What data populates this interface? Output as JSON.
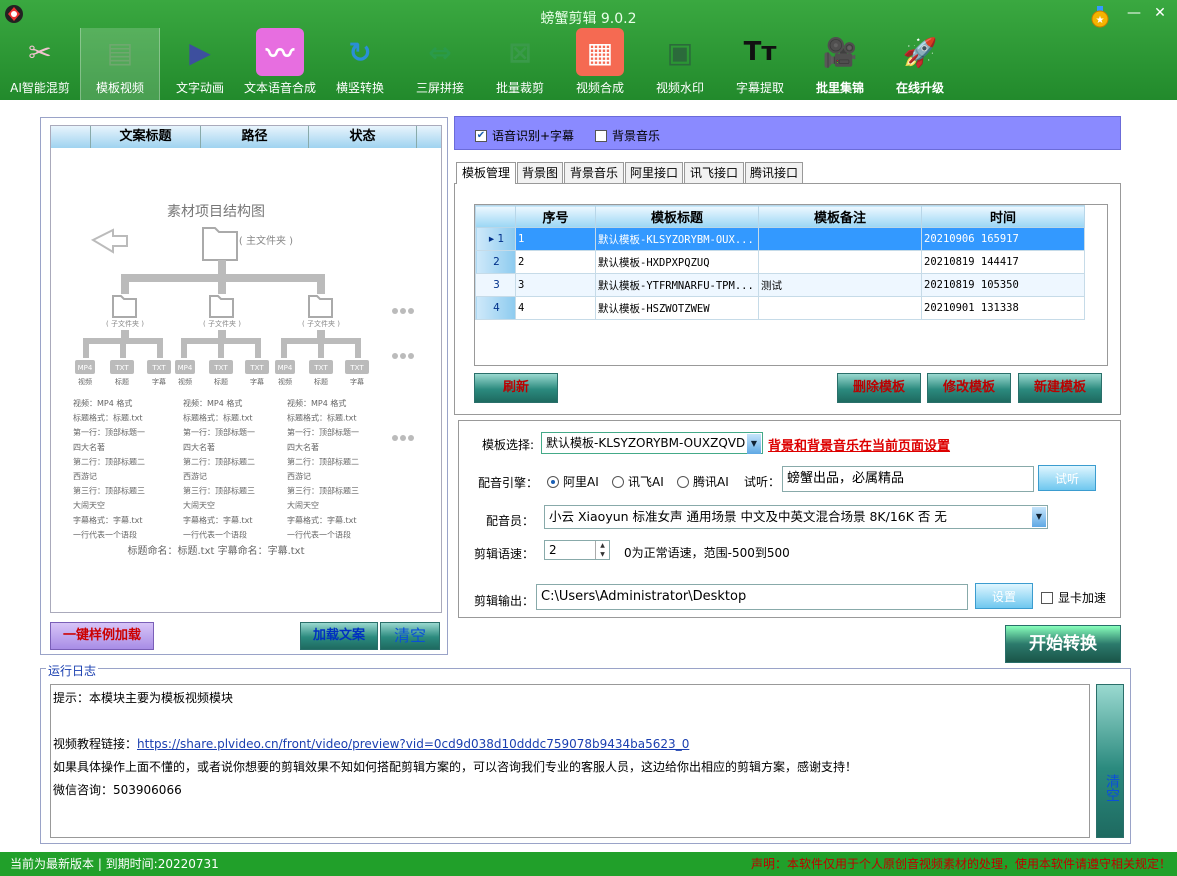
{
  "window": {
    "title": "螃蟹剪辑 9.0.2"
  },
  "toolbar": [
    {
      "label": "AI智能混剪",
      "icon": "ai-mix-icon"
    },
    {
      "label": "模板视频",
      "icon": "template-video-icon"
    },
    {
      "label": "文字动画",
      "icon": "text-animation-icon"
    },
    {
      "label": "文本语音合成",
      "icon": "tts-icon"
    },
    {
      "label": "横竖转换",
      "icon": "rotate-icon"
    },
    {
      "label": "三屏拼接",
      "icon": "three-screen-icon"
    },
    {
      "label": "批量裁剪",
      "icon": "crop-icon"
    },
    {
      "label": "视频合成",
      "icon": "video-merge-icon"
    },
    {
      "label": "视频水印",
      "icon": "watermark-icon"
    },
    {
      "label": "字幕提取",
      "icon": "subtitle-icon"
    },
    {
      "label": "批里集锦",
      "icon": "camera-icon"
    },
    {
      "label": "在线升级",
      "icon": "rocket-icon"
    }
  ],
  "left": {
    "columns": [
      "文案标题",
      "路径",
      "状态"
    ],
    "diagram": {
      "title": "素材项目结构图",
      "main_folder": "( 主文件夹 )",
      "sub_folder": "( 子文件夹 )",
      "file_labels": [
        "视频",
        "标题",
        "字幕"
      ],
      "txt_label": "TXT",
      "mp4_label": "MP4",
      "notes": [
        "视频：MP4 格式",
        "标题格式：标题.txt",
        "第一行：顶部标题一",
        "四大名著",
        "第二行：顶部标题二",
        "西游记",
        "第三行：顶部标题三",
        "大闹天空",
        "字幕格式：字幕.txt",
        "一行代表一个语段"
      ],
      "footer": "标题命名：标题.txt 字幕命名：字幕.txt"
    },
    "btn_sample": "一键样例加载",
    "btn_load": "加载文案",
    "btn_clear": "清空"
  },
  "options": {
    "asr_label": "语音识别+字幕",
    "asr_checked": true,
    "bgm_label": "背景音乐",
    "bgm_checked": false
  },
  "tabs": [
    "模板管理",
    "背景图",
    "背景音乐",
    "阿里接口",
    "讯飞接口",
    "腾讯接口"
  ],
  "template_table": {
    "columns": [
      "序号",
      "模板标题",
      "模板备注",
      "时间"
    ],
    "rows": [
      {
        "idx": "1",
        "no": "1",
        "title": "默认模板-KLSYZORYBM-OUX...",
        "note": "",
        "time": "20210906 165917"
      },
      {
        "idx": "2",
        "no": "2",
        "title": "默认模板-HXDPXPQZUQ",
        "note": "",
        "time": "20210819 144417"
      },
      {
        "idx": "3",
        "no": "3",
        "title": "默认模板-YTFRMNARFU-TPM...",
        "note": "测试",
        "time": "20210819 105350"
      },
      {
        "idx": "4",
        "no": "4",
        "title": "默认模板-HSZWOTZWEW",
        "note": "",
        "time": "20210901 131338"
      }
    ],
    "selected_row": 0
  },
  "table_buttons": {
    "refresh": "刷新",
    "delete": "删除模板",
    "modify": "修改模板",
    "new": "新建模板"
  },
  "settings": {
    "template_label": "模板选择:",
    "template_value": "默认模板-KLSYZORYBM-OUXZQVD",
    "template_hint": "背景和背景音乐在当前页面设置",
    "engine_label": "配音引擎：",
    "engines": [
      "阿里AI",
      "讯飞AI",
      "腾讯AI"
    ],
    "engine_selected": 0,
    "trial_label": "试听：",
    "trial_text": "螃蟹出品，必属精品",
    "trial_button": "试听",
    "voice_label": "配音员：",
    "voice_value": "小云 Xiaoyun 标准女声 通用场景 中文及中英文混合场景 8K/16K 否 无",
    "speed_label": "剪辑语速：",
    "speed_value": "2",
    "speed_hint": "0为正常语速，范围-500到500",
    "output_label": "剪辑输出：",
    "output_value": "C:\\Users\\Administrator\\Desktop",
    "output_button": "设置",
    "gpu_label": "显卡加速",
    "gpu_checked": false
  },
  "start_button": "开始转换",
  "log": {
    "title": "运行日志",
    "line1": "提示：本模块主要为模板视频模块",
    "line2_prefix": "视频教程链接：",
    "line2_link": "https://share.plvideo.cn/front/video/preview?vid=0cd9d038d10dddc759078b9434ba5623_0",
    "line3": "如果具体操作上面不懂的，或者说你想要的剪辑效果不知如何搭配剪辑方案的，可以咨询我们专业的客服人员，这边给你出相应的剪辑方案，感谢支持！",
    "line4": "微信咨询：503906066",
    "clear_button": "清空"
  },
  "status": {
    "left": "当前为最新版本 | 到期时间:20220731",
    "right": "声明：本软件仅用于个人原创音视频素材的处理，使用本软件请遵守相关规定！"
  }
}
